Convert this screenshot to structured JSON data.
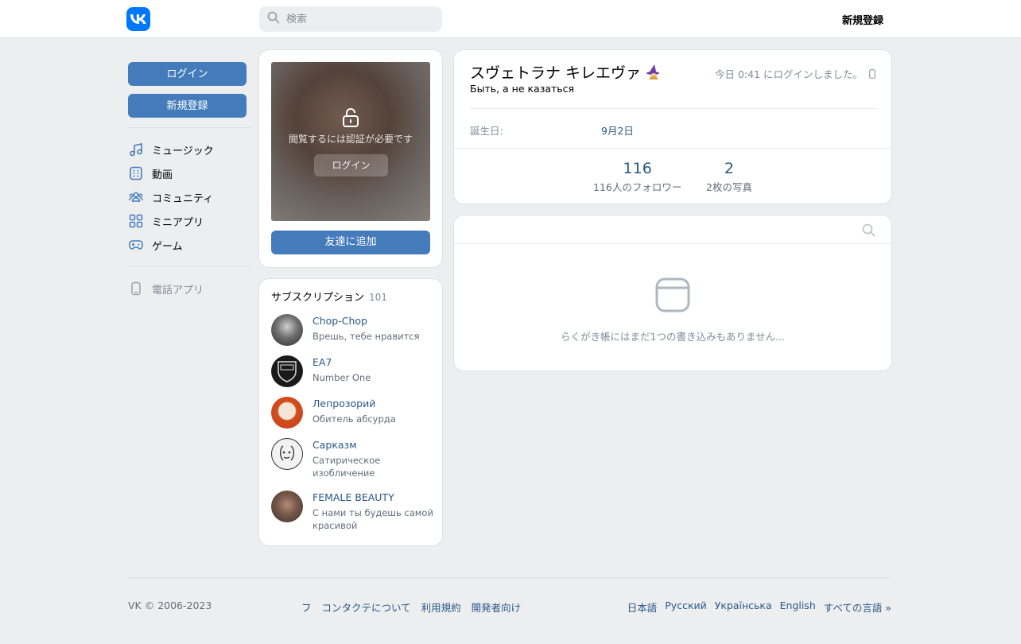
{
  "header": {
    "search_placeholder": "検索",
    "register": "新規登録"
  },
  "leftnav": {
    "login": "ログイン",
    "register": "新規登録",
    "items": [
      {
        "label": "ミュージック",
        "icon": "music-icon"
      },
      {
        "label": "動画",
        "icon": "video-icon"
      },
      {
        "label": "コミュニティ",
        "icon": "communities-icon"
      },
      {
        "label": "ミニアプリ",
        "icon": "mini-apps-icon"
      },
      {
        "label": "ゲーム",
        "icon": "gamepad-icon"
      }
    ],
    "phone_app": "電話アプリ"
  },
  "photo": {
    "lock_text": "閲覧するには認証が必要です",
    "login": "ログイン",
    "add_friend": "友達に追加"
  },
  "subscriptions": {
    "title": "サブスクリプション",
    "count": "101",
    "items": [
      {
        "name": "Chop-Chop",
        "desc": "Врешь, тебе нравится"
      },
      {
        "name": "EA7",
        "desc": "Number One"
      },
      {
        "name": "Лепрозорий",
        "desc": "Обитель абсурда"
      },
      {
        "name": "Сарказм",
        "desc": "Сатирическое изобличение"
      },
      {
        "name": "FEMALE BEAUTY",
        "desc": "С нами ты будешь самой красивой"
      }
    ]
  },
  "profile": {
    "name": "スヴェトラナ キレエヴァ",
    "status": "Быть, а не казаться",
    "last_seen": "今日 0:41 にログインしました。",
    "birthday_label": "誕生日:",
    "birthday_value": "9月2日",
    "followers_count": "116",
    "followers_label": "116人のフォロワー",
    "photos_count": "2",
    "photos_label": "2枚の写真"
  },
  "wall": {
    "empty": "らくがき帳にはまだ1つの書き込みもありません..."
  },
  "footer": {
    "copyright": "VK © 2006-2023",
    "links": [
      "フ",
      "コンタクテについて",
      "利用規約",
      "開発者向け"
    ],
    "langs": [
      "日本語",
      "Русский",
      "Українська",
      "English",
      "すべての言語 »"
    ]
  },
  "colors": {
    "accent": "#447bba",
    "brand": "#0077ff",
    "link": "#2a5885",
    "background": "#edeef0"
  }
}
